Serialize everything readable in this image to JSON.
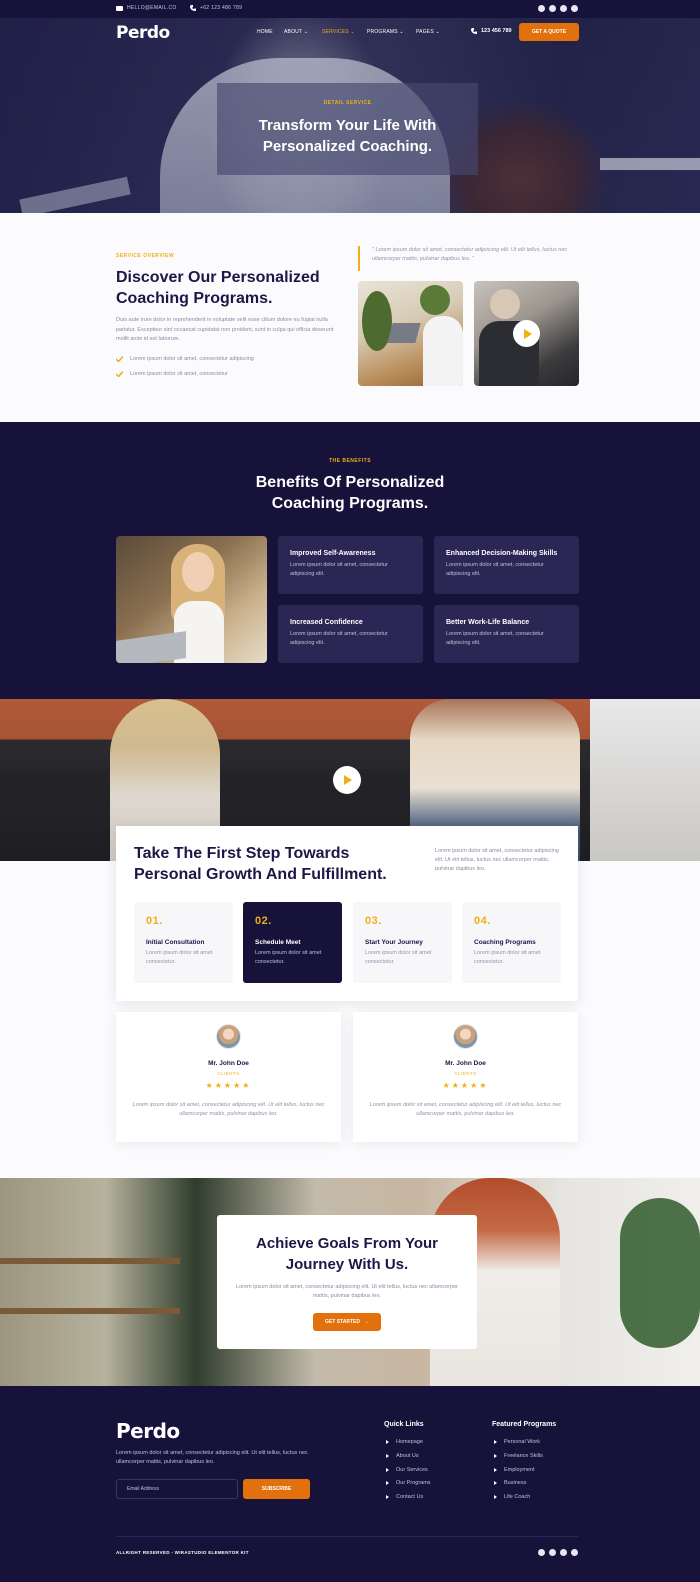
{
  "topbar": {
    "email": "HELLO@EMAIL.CO",
    "phone": "+62 123 486 789",
    "social_icons": [
      "facebook-icon",
      "twitter-icon",
      "youtube-icon",
      "pinterest-icon"
    ]
  },
  "header": {
    "logo": "Perdo",
    "nav": [
      "HOME",
      "ABOUT",
      "SERVICES",
      "PROGRAMS",
      "PAGES"
    ],
    "active_nav": "SERVICES",
    "phone": "123 456 789",
    "cta": "GET A QUOTE"
  },
  "hero": {
    "eyebrow": "DETAIL SERVICE",
    "title_line1": "Transform Your Life With",
    "title_line2": "Personalized Coaching."
  },
  "overview": {
    "eyebrow": "SERVICE OVERVIEW",
    "title_line1": "Discover Our Personalized",
    "title_line2": "Coaching Programs.",
    "text": "Duis aute irure dolor in reprehenderit in voluptate velit esse cillum dolore eu fugiat nulla pariatur. Excepteur sint occaecat cupidatat non proident, sunt in culpa qui officia deserunt mollit anim id est laborum.",
    "checks": [
      "Lorem ipsum dolor sit amet, consectetur adipiscing",
      "Lorem ipsum dolor sit amet, consectetur"
    ],
    "quote": "\" Lorem ipsum dolor sit amet, consectetur adipiscing elit. Ut elit tellus, luctus nec ullamcorper mattis, pulvinar dapibus leo. \""
  },
  "benefits": {
    "eyebrow": "THE BENEFITS",
    "title_line1": "Benefits Of Personalized",
    "title_line2": "Coaching Programs.",
    "cards": [
      {
        "title": "Improved Self-Awareness",
        "text": "Lorem ipsum dolor sit amet, consectetur adipiscing elit."
      },
      {
        "title": "Enhanced Decision-Making Skills",
        "text": "Lorem ipsum dolor sit amet, consectetur adipiscing elit."
      },
      {
        "title": "Increased Confidence",
        "text": "Lorem ipsum dolor sit amet, consectetur adipiscing elit."
      },
      {
        "title": "Better Work-Life Balance",
        "text": "Lorem ipsum dolor sit amet, consectetur adipiscing elit."
      }
    ]
  },
  "steps": {
    "title_line1": "Take The First Step Towards",
    "title_line2": "Personal Growth And Fulfillment.",
    "text": "Lorem ipsum dolor sit amet, consectetur adipiscing elit. Ut elit tellus, luctus nec ullamcorper mattis, pulvinar dapibus leo.",
    "items": [
      {
        "num": "01.",
        "title": "Initial Consultation",
        "text": "Lorem ipsum dolor sit amet consectetur."
      },
      {
        "num": "02.",
        "title": "Schedule Meet",
        "text": "Lorem ipsum dolor sit amet consectetur."
      },
      {
        "num": "03.",
        "title": "Start Your Journey",
        "text": "Lorem ipsum dolor sit amet consectetur."
      },
      {
        "num": "04.",
        "title": "Coaching Programs",
        "text": "Lorem ipsum dolor sit amet consectetur."
      }
    ],
    "active_index": 1
  },
  "testimonials": [
    {
      "name": "Mr. John Doe",
      "role": "CLIENTS",
      "stars": "★★★★★",
      "text": "Lorem ipsum dolor sit amet, consectetur adipiscing elit. Ut elit tellus, luctus nec ullamcorper mattis, pulvinar dapibus leo."
    },
    {
      "name": "Mr. John Doe",
      "role": "CLIENTS",
      "stars": "★★★★★",
      "text": "Lorem ipsum dolor sit amet, consectetur adipiscing elit. Ut elit tellus, luctus nec ullamcorper mattis, pulvinar dapibus leo."
    }
  ],
  "achieve": {
    "title_line1": "Achieve Goals From Your",
    "title_line2": "Journey With Us.",
    "text": "Lorem ipsum dolor sit amet, consectetur adipiscing elit. Ut elit tellus, luctus nec ullamcorper mattis, pulvinar dapibus leo.",
    "cta": "GET STARTED"
  },
  "footer": {
    "logo": "Perdo",
    "text": "Lorem ipsum dolor sit amet, consectetur adipiscing elit. Ut elit tellus, luctus nec ullamcorper mattis, pulvinar dapibus leo.",
    "email_placeholder": "Email Address",
    "subscribe": "SUBSCRIBE",
    "quick_links_title": "Quick Links",
    "quick_links": [
      "Homepage",
      "About Us",
      "Our Services",
      "Our Programs",
      "Contact Us"
    ],
    "programs_title": "Featured Programs",
    "programs": [
      "Personal Work",
      "Freelance Skills",
      "Employment",
      "Business",
      "Life Coach"
    ],
    "copyright": "ALLRIGHT RESERVED - WIRASTUDIO ELEMENTOR KIT"
  },
  "colors": {
    "navy": "#17123a",
    "accent": "#f0ae17",
    "orange": "#e2700d",
    "card": "#2c2654"
  }
}
